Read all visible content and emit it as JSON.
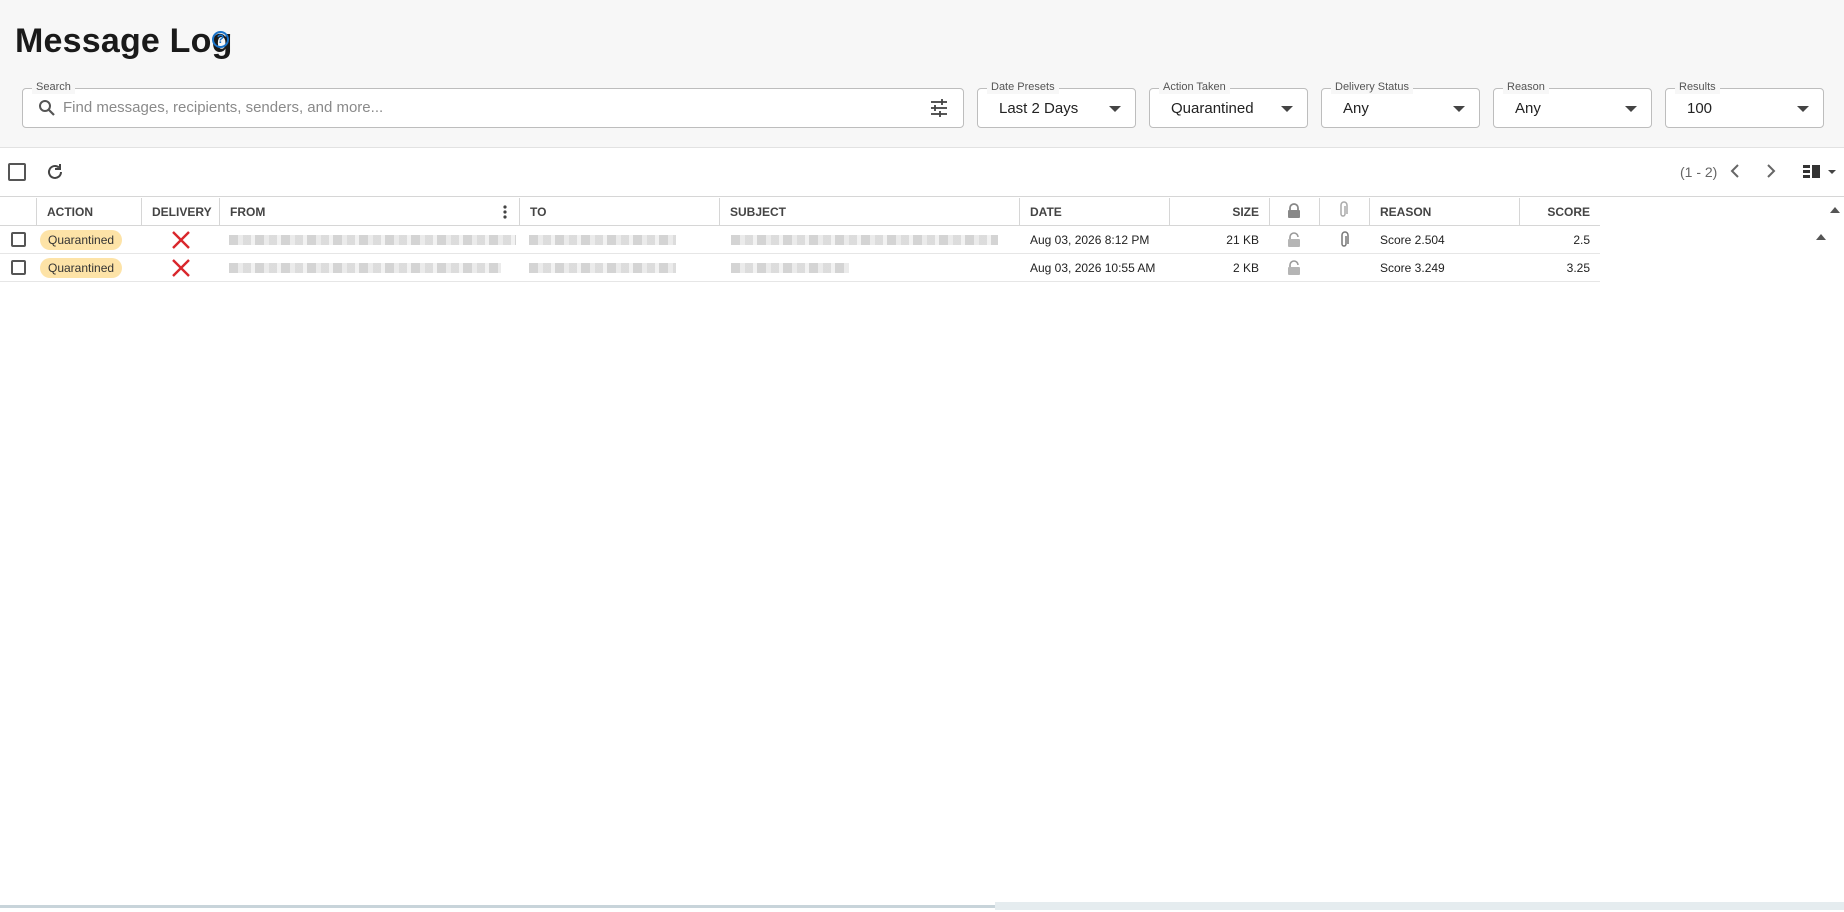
{
  "header": {
    "title": "Message Log"
  },
  "filters": {
    "search": {
      "label": "Search",
      "placeholder": "Find messages, recipients, senders, and more...",
      "value": ""
    },
    "date_presets": {
      "label": "Date Presets",
      "value": "Last 2 Days"
    },
    "action_taken": {
      "label": "Action Taken",
      "value": "Quarantined"
    },
    "delivery_status": {
      "label": "Delivery Status",
      "value": "Any"
    },
    "reason": {
      "label": "Reason",
      "value": "Any"
    },
    "results": {
      "label": "Results",
      "value": "100"
    }
  },
  "toolbar": {
    "range": "(1 - 2)"
  },
  "table": {
    "headers": {
      "action": "ACTION",
      "delivery": "DELIVERY",
      "from": "FROM",
      "to": "TO",
      "subject": "SUBJECT",
      "date": "DATE",
      "size": "SIZE",
      "reason": "REASON",
      "score": "SCORE"
    },
    "rows": [
      {
        "action": "Quarantined",
        "date": "Aug 03, 2026 8:12 PM",
        "size": "21 KB",
        "reason": "Score 2.504",
        "score": "2.5"
      },
      {
        "action": "Quarantined",
        "date": "Aug 03, 2026 10:55 AM",
        "size": "2 KB",
        "reason": "Score 3.249",
        "score": "3.25"
      }
    ]
  },
  "colors": {
    "accent": "#1a73c9",
    "badge": "#fde3a7",
    "delivery_failed": "#d9262c"
  },
  "icons": [
    "help-icon",
    "search-icon",
    "filter-settings-icon",
    "chevron-down-icon",
    "refresh-icon",
    "chevron-left-icon",
    "chevron-right-icon",
    "column-layout-icon",
    "lock-icon",
    "paperclip-icon",
    "x-icon",
    "more-vert-icon"
  ]
}
